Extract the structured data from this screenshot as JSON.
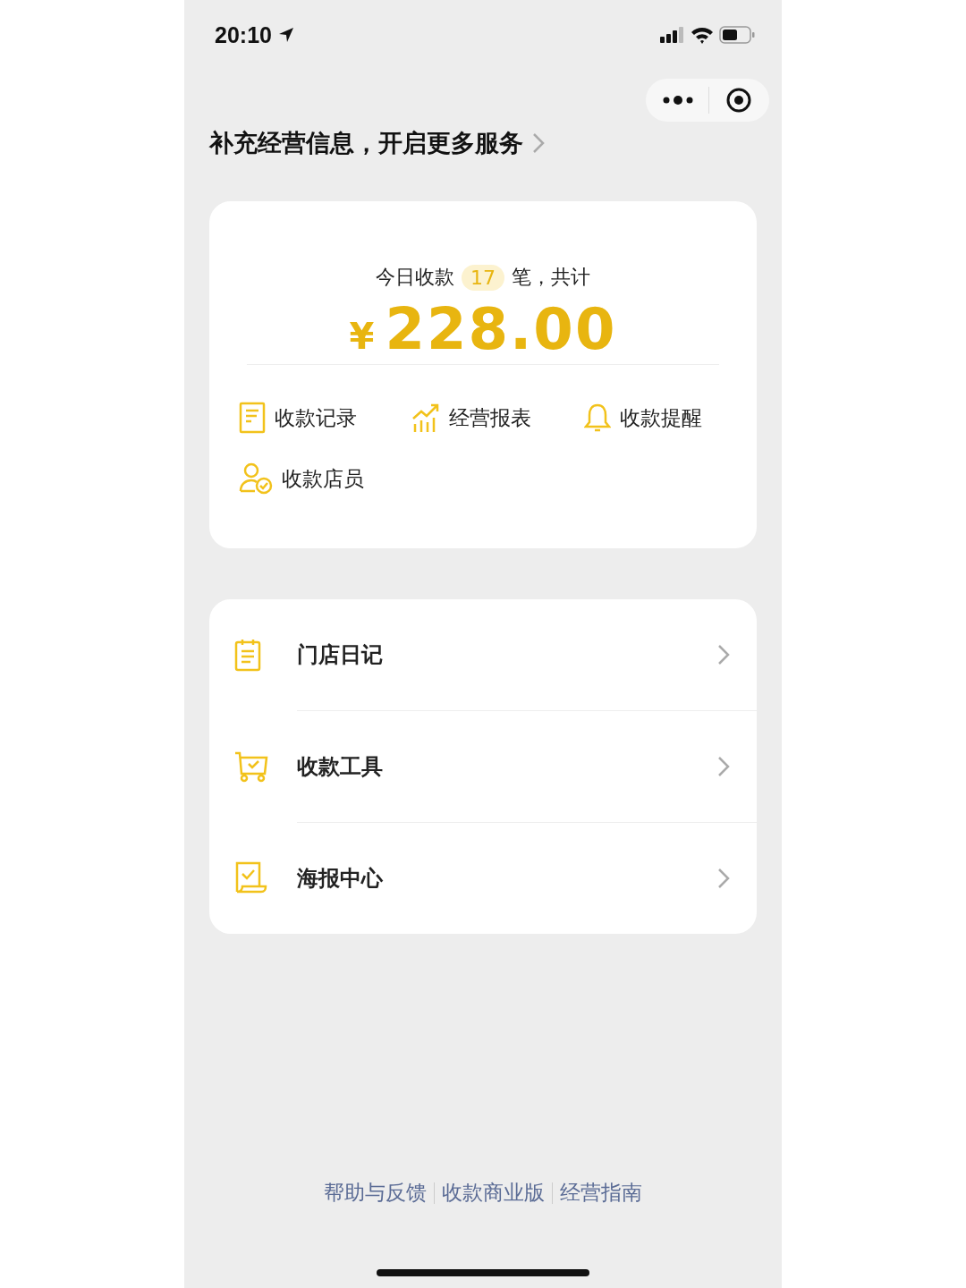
{
  "status_bar": {
    "time": "20:10"
  },
  "banner": {
    "text": "补充经营信息，开启更多服务"
  },
  "summary": {
    "prefix": "今日收款",
    "count": "17",
    "suffix": "笔，共计",
    "currency": "¥",
    "amount": "228.00"
  },
  "shortcuts": [
    {
      "label": "收款记录"
    },
    {
      "label": "经营报表"
    },
    {
      "label": "收款提醒"
    },
    {
      "label": "收款店员"
    }
  ],
  "menu": [
    {
      "label": "门店日记"
    },
    {
      "label": "收款工具"
    },
    {
      "label": "海报中心"
    }
  ],
  "footer_links": [
    "帮助与反馈",
    "收款商业版",
    "经营指南"
  ]
}
